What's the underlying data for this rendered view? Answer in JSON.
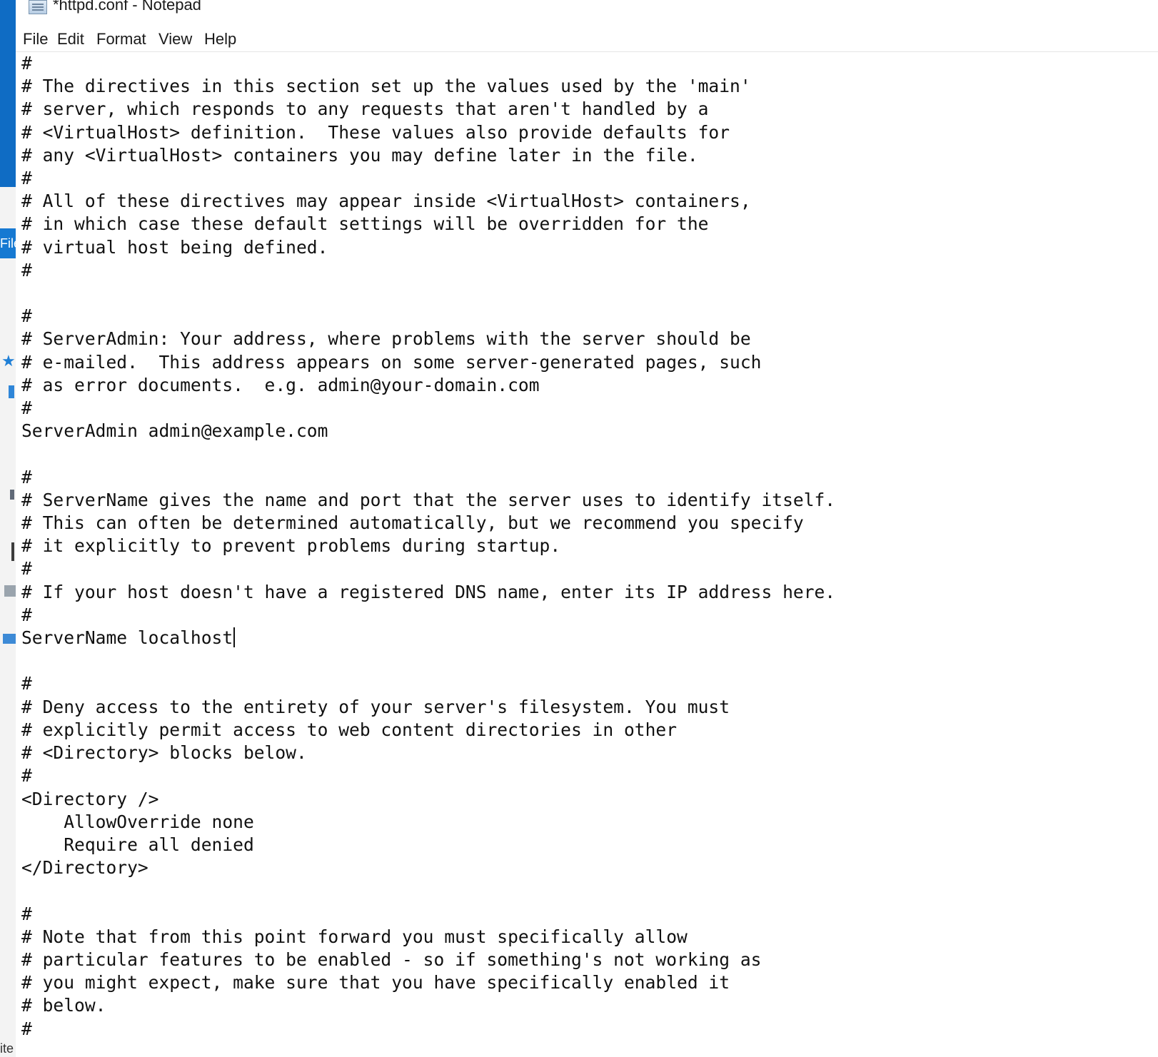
{
  "window": {
    "title": "*httpd.conf - Notepad"
  },
  "background_window": {
    "tab_label": "File",
    "bottom_label": "ite"
  },
  "menu": {
    "file": "File",
    "edit": "Edit",
    "format": "Format",
    "view": "View",
    "help": "Help"
  },
  "document": {
    "before_caret": "#\n# The directives in this section set up the values used by the 'main'\n# server, which responds to any requests that aren't handled by a\n# <VirtualHost> definition.  These values also provide defaults for\n# any <VirtualHost> containers you may define later in the file.\n#\n# All of these directives may appear inside <VirtualHost> containers,\n# in which case these default settings will be overridden for the\n# virtual host being defined.\n#\n\n#\n# ServerAdmin: Your address, where problems with the server should be\n# e-mailed.  This address appears on some server-generated pages, such\n# as error documents.  e.g. admin@your-domain.com\n#\nServerAdmin admin@example.com\n\n#\n# ServerName gives the name and port that the server uses to identify itself.\n# This can often be determined automatically, but we recommend you specify\n# it explicitly to prevent problems during startup.\n#\n# If your host doesn't have a registered DNS name, enter its IP address here.\n#\nServerName localhost",
    "after_caret": "\n\n#\n# Deny access to the entirety of your server's filesystem. You must\n# explicitly permit access to web content directories in other\n# <Directory> blocks below.\n#\n<Directory />\n    AllowOverride none\n    Require all denied\n</Directory>\n\n#\n# Note that from this point forward you must specifically allow\n# particular features to be enabled - so if something's not working as\n# you might expect, make sure that you have specifically enabled it\n# below.\n#"
  },
  "colors": {
    "accent": "#0f6cc4",
    "text": "#111111",
    "background": "#ffffff"
  },
  "icons": {
    "app": "notepad-icon",
    "strip": [
      "star-icon",
      "pc-icon"
    ]
  }
}
